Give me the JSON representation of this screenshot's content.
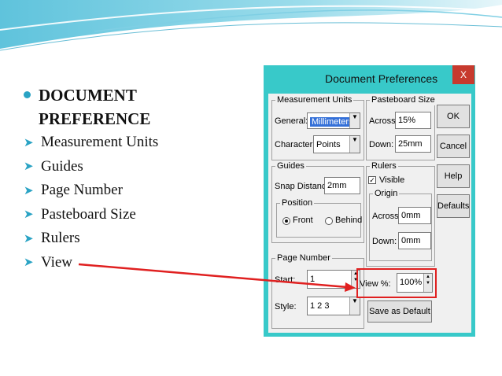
{
  "slide": {
    "heading_line1": "DOCUMENT",
    "heading_line2": "PREFERENCE",
    "items": [
      "Measurement Units",
      "Guides",
      "Page Number",
      "Pasteboard Size",
      "Rulers",
      "View"
    ]
  },
  "dialog": {
    "title": "Document Preferences",
    "close_label": "X",
    "measurement_units": {
      "group_label": "Measurement Units",
      "general_label": "General:",
      "general_value": "Millimeters",
      "character_label": "Character:",
      "character_value": "Points"
    },
    "pasteboard_size": {
      "group_label": "Pasteboard Size",
      "across_label": "Across:",
      "across_value": "15%",
      "down_label": "Down:",
      "down_value": "25mm"
    },
    "guides": {
      "group_label": "Guides",
      "snap_label": "Snap Distance:",
      "snap_value": "2mm",
      "position_label": "Position",
      "front_label": "Front",
      "behind_label": "Behind",
      "position_selected": "Front"
    },
    "rulers": {
      "group_label": "Rulers",
      "visible_label": "Visible",
      "visible_checked": true,
      "origin_label": "Origin",
      "across_label": "Across:",
      "across_value": "0mm",
      "down_label": "Down:",
      "down_value": "0mm"
    },
    "page_number": {
      "group_label": "Page Number",
      "start_label": "Start:",
      "start_value": "1",
      "style_label": "Style:",
      "style_value": "1 2 3"
    },
    "view": {
      "label": "View %:",
      "value": "100%"
    },
    "buttons": {
      "ok": "OK",
      "cancel": "Cancel",
      "help": "Help",
      "defaults": "Defaults",
      "save_default": "Save as Default"
    }
  },
  "colors": {
    "accent": "#2aa3c4",
    "dialog_frame": "#38c9c9",
    "close_button": "#c73a2e",
    "highlight": "#e02020"
  }
}
